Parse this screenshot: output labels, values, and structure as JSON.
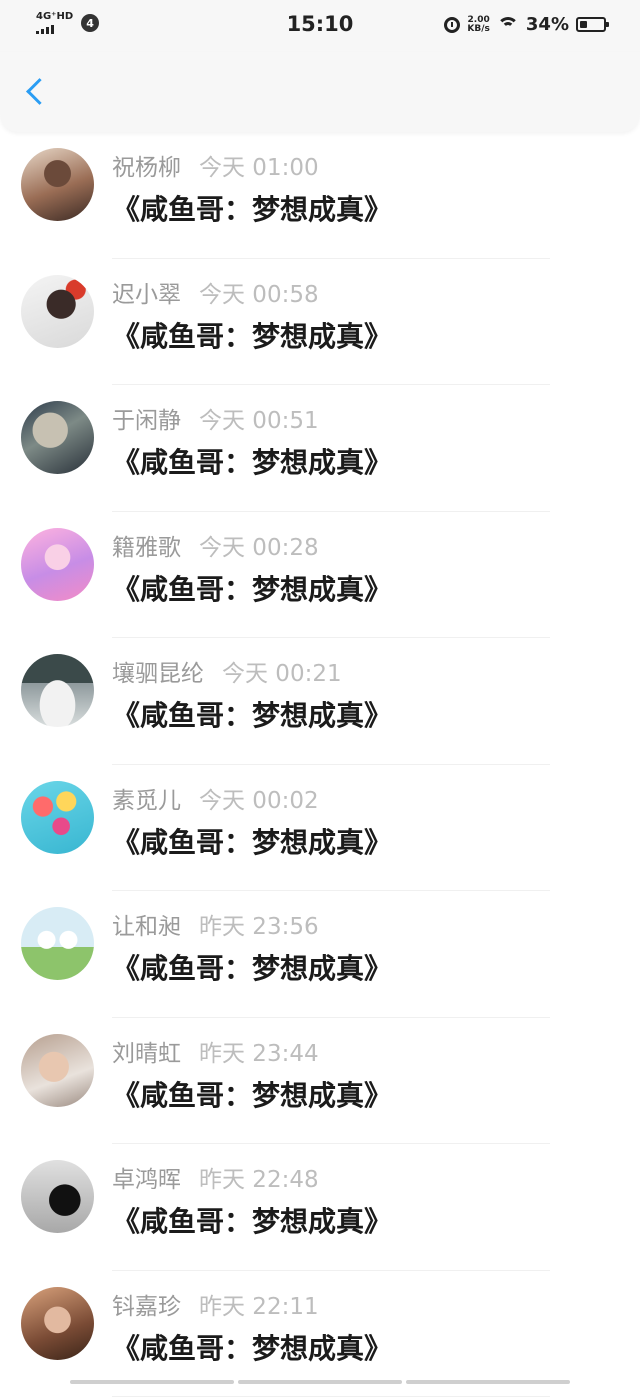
{
  "status_bar": {
    "network": "4G⁺HD",
    "notification_count": "4",
    "time": "15:10",
    "speed_value": "2.00",
    "speed_unit": "KB/s",
    "battery_percent": "34%",
    "battery_level": 0.34
  },
  "nav": {
    "back_icon": "chevron-left-icon",
    "accent_color": "#2a9df4"
  },
  "colors": {
    "name": "#9a9a9a",
    "time": "#bdbdbd",
    "message": "#1b1b1b"
  },
  "items": [
    {
      "name": "祝杨柳",
      "time": "今天 01:00",
      "message": "《咸鱼哥：梦想成真》"
    },
    {
      "name": "迟小翠",
      "time": "今天 00:58",
      "message": "《咸鱼哥：梦想成真》"
    },
    {
      "name": "于闲静",
      "time": "今天 00:51",
      "message": "《咸鱼哥：梦想成真》"
    },
    {
      "name": "籍雅歌",
      "time": "今天 00:28",
      "message": "《咸鱼哥：梦想成真》"
    },
    {
      "name": "壤驷昆纶",
      "time": "今天 00:21",
      "message": "《咸鱼哥：梦想成真》"
    },
    {
      "name": "素觅儿",
      "time": "今天 00:02",
      "message": "《咸鱼哥：梦想成真》"
    },
    {
      "name": "让和昶",
      "time": "昨天 23:56",
      "message": "《咸鱼哥：梦想成真》"
    },
    {
      "name": "刘晴虹",
      "time": "昨天 23:44",
      "message": "《咸鱼哥：梦想成真》"
    },
    {
      "name": "卓鸿晖",
      "time": "昨天 22:48",
      "message": "《咸鱼哥：梦想成真》"
    },
    {
      "name": "钭嘉珍",
      "time": "昨天 22:11",
      "message": "《咸鱼哥：梦想成真》"
    }
  ]
}
